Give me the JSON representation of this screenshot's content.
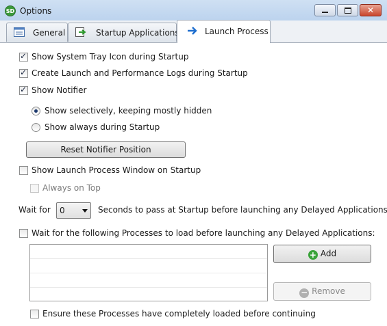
{
  "window": {
    "title": "Options",
    "app_icon_text": "SD",
    "close_glyph": "✕"
  },
  "tabs": [
    {
      "label": "General",
      "icon": "window-icon"
    },
    {
      "label": "Startup Applications",
      "icon": "startup-arrow-icon"
    },
    {
      "label": "Launch Process",
      "icon": "arrow-right-icon"
    }
  ],
  "launch": {
    "show_tray_icon": {
      "label": "Show System Tray Icon during Startup",
      "checked": true
    },
    "create_logs": {
      "label": "Create Launch and Performance Logs during Startup",
      "checked": true
    },
    "show_notifier": {
      "label": "Show Notifier",
      "checked": true
    },
    "notifier_mode": {
      "selective": {
        "label": "Show selectively, keeping mostly hidden",
        "checked": true
      },
      "always": {
        "label": "Show always during Startup",
        "checked": false
      }
    },
    "reset_notifier_button": "Reset Notifier Position",
    "show_launch_window": {
      "label": "Show Launch Process Window on Startup",
      "checked": false
    },
    "always_on_top": {
      "label": "Always on Top",
      "checked": false,
      "disabled": true
    },
    "wait": {
      "prefix": "Wait for",
      "value": "0",
      "suffix": "Seconds to pass at Startup before launching any Delayed Applications"
    },
    "wait_processes": {
      "label": "Wait for the following Processes to load before launching any Delayed Applications:",
      "checked": false
    },
    "add_button": "Add",
    "remove_button": "Remove",
    "ensure_loaded": {
      "label": "Ensure these Processes have completely loaded before continuing",
      "checked": false
    }
  }
}
